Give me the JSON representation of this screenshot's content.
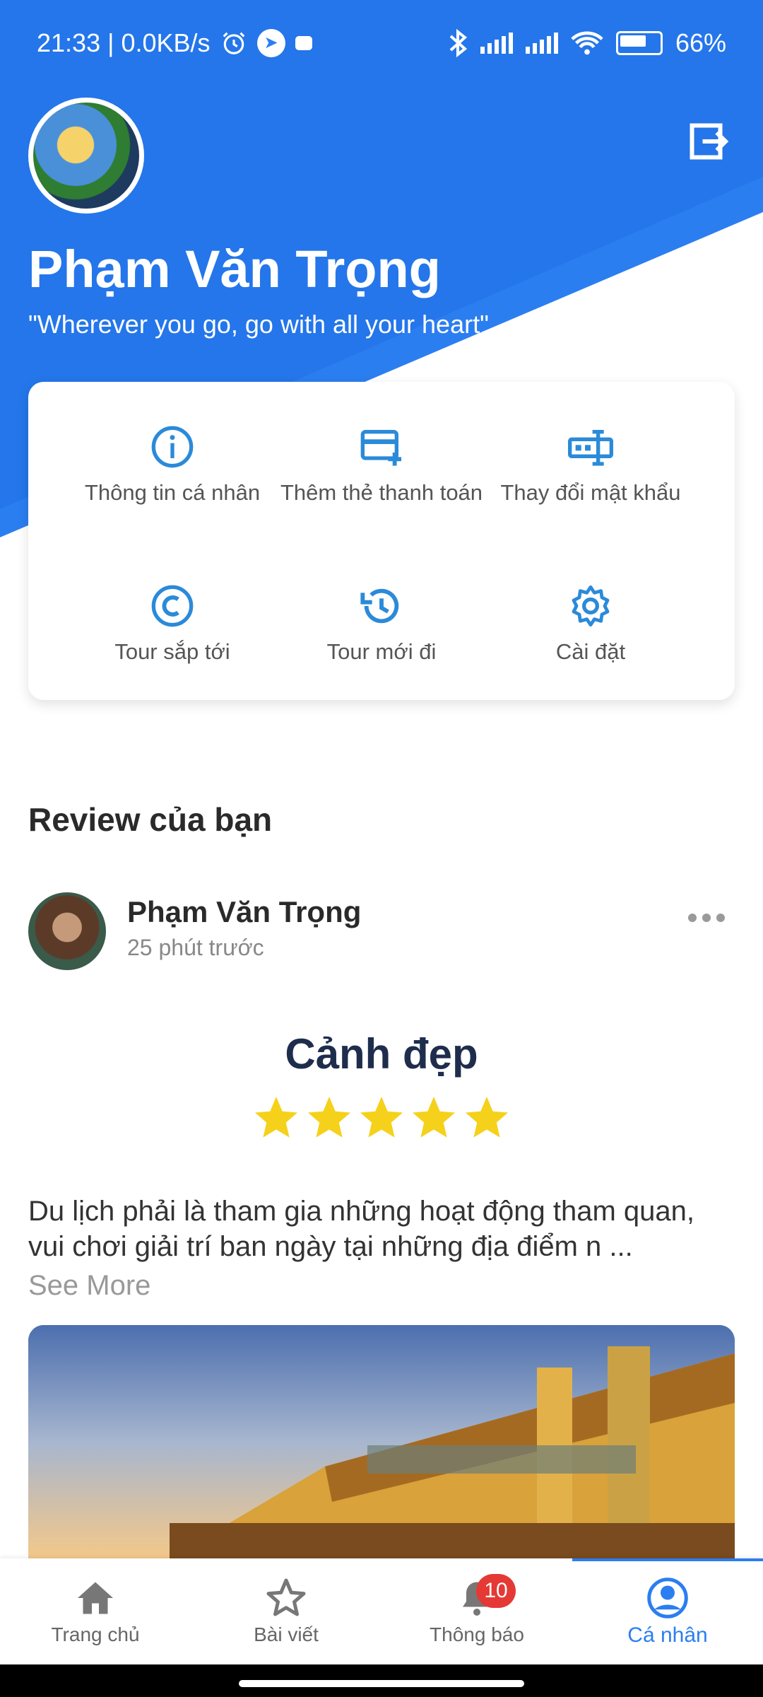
{
  "status_bar": {
    "time_speed": "21:33 | 0.0KB/s",
    "battery": "66%"
  },
  "profile": {
    "name": "Phạm Văn Trọng",
    "quote": "\"Wherever you go, go with all your heart\""
  },
  "menu": [
    {
      "label": "Thông tin cá nhân",
      "icon": "info-icon"
    },
    {
      "label": "Thêm thẻ thanh toán",
      "icon": "add-card-icon"
    },
    {
      "label": "Thay đổi mật khẩu",
      "icon": "password-icon"
    },
    {
      "label": "Tour sắp tới",
      "icon": "upcoming-icon"
    },
    {
      "label": "Tour mới đi",
      "icon": "history-icon"
    },
    {
      "label": "Cài đặt",
      "icon": "gear-icon"
    }
  ],
  "reviews": {
    "section_title": "Review của bạn",
    "item": {
      "author": "Phạm Văn Trọng",
      "time": "25 phút trước",
      "title": "Cảnh đẹp",
      "rating": 5,
      "text": "Du lịch phải là tham gia những hoạt động tham quan, vui chơi giải trí ban ngày tại những địa điểm n ...",
      "see_more": "See More"
    }
  },
  "bottom_nav": [
    {
      "label": "Trang chủ",
      "icon": "home-icon"
    },
    {
      "label": "Bài viết",
      "icon": "star-icon"
    },
    {
      "label": "Thông báo",
      "icon": "bell-icon",
      "badge": "10"
    },
    {
      "label": "Cá nhân",
      "icon": "profile-icon",
      "active": true
    }
  ],
  "colors": {
    "primary": "#2b7ef0",
    "star": "#f5d11b",
    "badge": "#e53935"
  }
}
